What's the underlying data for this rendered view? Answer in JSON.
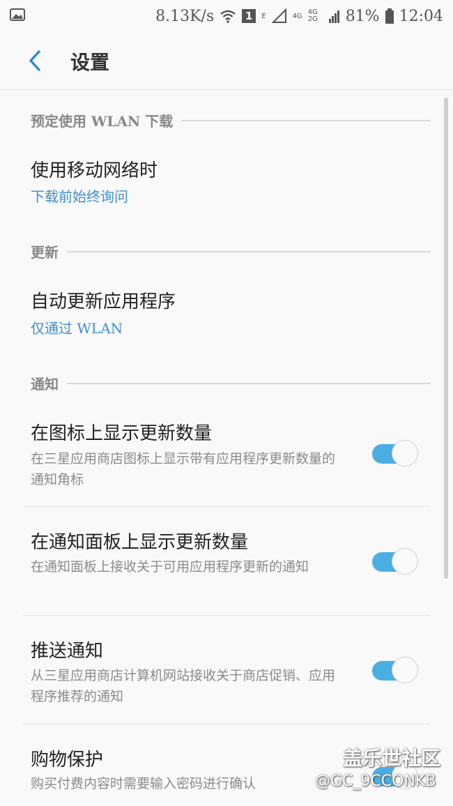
{
  "status_bar": {
    "speed": "8.13K/s",
    "sim_badge": "1",
    "network_e": "E",
    "network_4g": "4G",
    "network_4g_2g": "4G 2G",
    "battery_percent": "81%",
    "time": "12:04"
  },
  "app_bar": {
    "title": "设置"
  },
  "sections": {
    "wlan_download": {
      "header": "预定使用 WLAN 下载",
      "mobile_network": {
        "title": "使用移动网络时",
        "value": "下载前始终询问"
      }
    },
    "update": {
      "header": "更新",
      "auto_update": {
        "title": "自动更新应用程序",
        "value": "仅通过 WLAN"
      }
    },
    "notifications": {
      "header": "通知",
      "badge_count": {
        "title": "在图标上显示更新数量",
        "desc": "在三星应用商店图标上显示带有应用程序更新数量的通知角标",
        "enabled": true
      },
      "panel_count": {
        "title": "在通知面板上显示更新数量",
        "desc": "在通知面板上接收关于可用应用程序更新的通知",
        "enabled": true
      },
      "push": {
        "title": "推送通知",
        "desc": "从三星应用商店计算机网站接收关于商店促销、应用程序推荐的通知",
        "enabled": true
      },
      "purchase_protection": {
        "title": "购物保护",
        "desc": "购买付费内容时需要输入密码进行确认",
        "enabled": true
      }
    }
  },
  "watermark": {
    "line1": "盖乐世社区",
    "line2": "@GC_9CCONKB"
  },
  "colors": {
    "accent": "#3d8fd4",
    "toggle_on": "#4aaee3"
  }
}
